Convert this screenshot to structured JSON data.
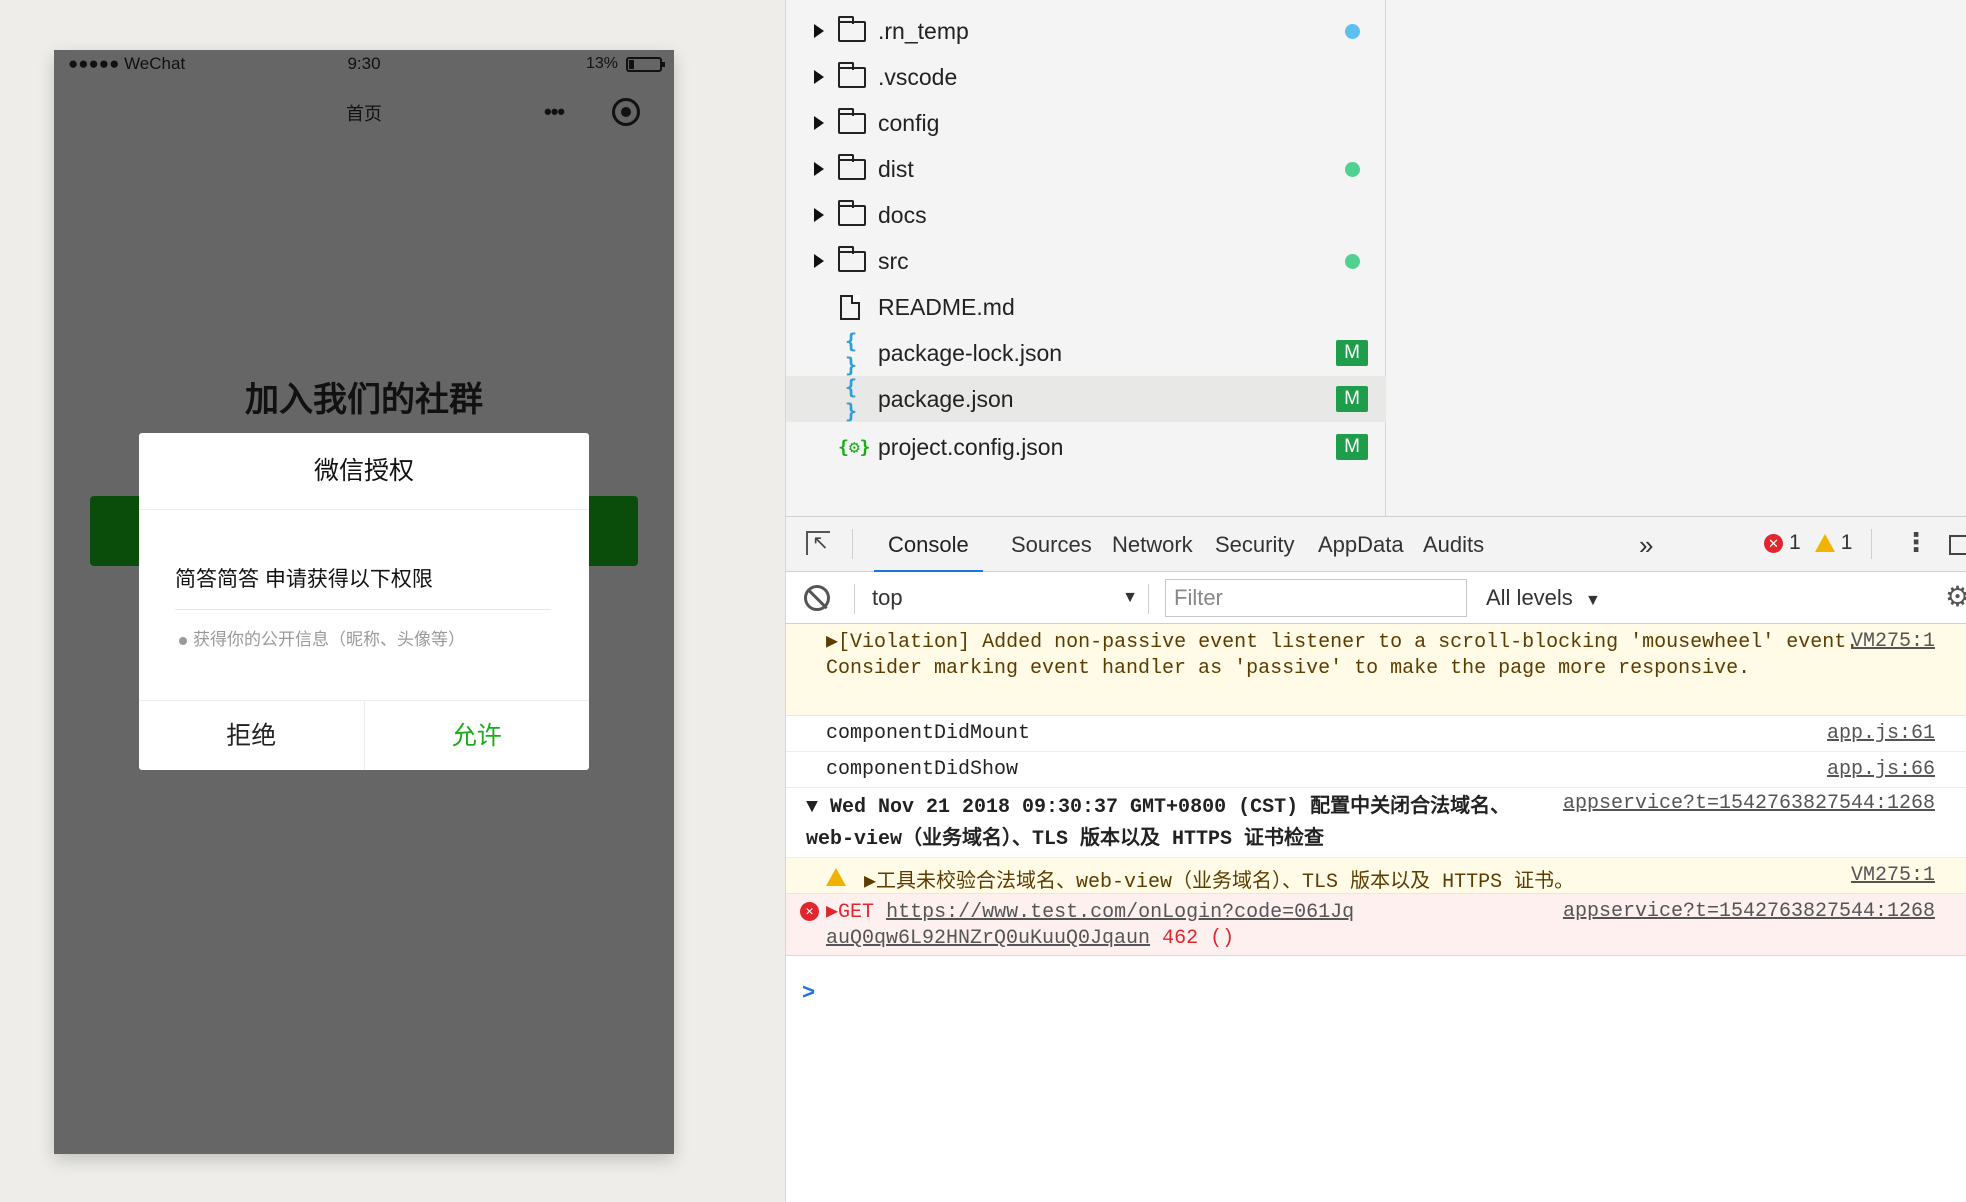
{
  "simulator": {
    "status": {
      "signal": "●●●●● WeChat",
      "time": "9:30",
      "battery": "13%"
    },
    "nav_title": "首页",
    "page_heading": "加入我们的社群",
    "dialog": {
      "title": "微信授权",
      "app_line": "简答简答 申请获得以下权限",
      "permission": "获得你的公开信息（昵称、头像等）",
      "reject": "拒绝",
      "allow": "允许",
      "allow_color": "#1aad19"
    }
  },
  "file_tree": {
    "items": [
      {
        "name": ".rn_temp",
        "type": "folder",
        "status": "dot",
        "status_color": "#5bc0f0"
      },
      {
        "name": ".vscode",
        "type": "folder"
      },
      {
        "name": "config",
        "type": "folder"
      },
      {
        "name": "dist",
        "type": "folder",
        "status": "dot",
        "status_color": "#4fd18f"
      },
      {
        "name": "docs",
        "type": "folder"
      },
      {
        "name": "src",
        "type": "folder",
        "status": "dot",
        "status_color": "#4fd18f"
      },
      {
        "name": "README.md",
        "type": "file"
      },
      {
        "name": "package-lock.json",
        "type": "json",
        "icon": "{ }",
        "status": "M"
      },
      {
        "name": "package.json",
        "type": "json",
        "icon": "{ }",
        "status": "M",
        "selected": true
      },
      {
        "name": "project.config.json",
        "type": "config",
        "icon": "{⚙}",
        "status": "M"
      }
    ]
  },
  "devtools": {
    "tabs": [
      "Console",
      "Sources",
      "Network",
      "Security",
      "AppData",
      "Audits"
    ],
    "active_tab": "Console",
    "more_tabs": "»",
    "error_count": "1",
    "warning_count": "1",
    "context": "top",
    "filter_placeholder": "Filter",
    "levels": "All levels",
    "accent_color": "#1a73e8"
  },
  "console": {
    "messages": [
      {
        "level": "warn",
        "arrow": "▶",
        "text": "[Violation] Added non-passive event listener to a scroll-blocking 'mousewheel' event. Consider marking event handler as 'passive' to make the page more responsive.",
        "source": "VM275:1"
      },
      {
        "level": "log",
        "text": "componentDidMount",
        "source": "app.js:61"
      },
      {
        "level": "log",
        "text": "componentDidShow",
        "source": "app.js:66"
      },
      {
        "level": "group",
        "arrow": "▼",
        "text": "Wed Nov 21 2018 09:30:37 GMT+0800 (CST) 配置中关闭合法域名、web-view（业务域名）、TLS 版本以及 HTTPS 证书检查",
        "source": "appservice?t=1542763827544:1268"
      },
      {
        "level": "warn",
        "arrow": "▶",
        "text": "工具未校验合法域名、web-view（业务域名）、TLS 版本以及 HTTPS 证书。",
        "source": "VM275:1"
      },
      {
        "level": "error",
        "arrow": "▶",
        "method": "GET",
        "url": "https://www.test.com/onLogin?code=061JqauQ0qw6L92HNZrQ0uKuuQ0Jqaun",
        "status": "462 ()",
        "source": "appservice?t=1542763827544:1268"
      }
    ],
    "prompt": ">"
  }
}
